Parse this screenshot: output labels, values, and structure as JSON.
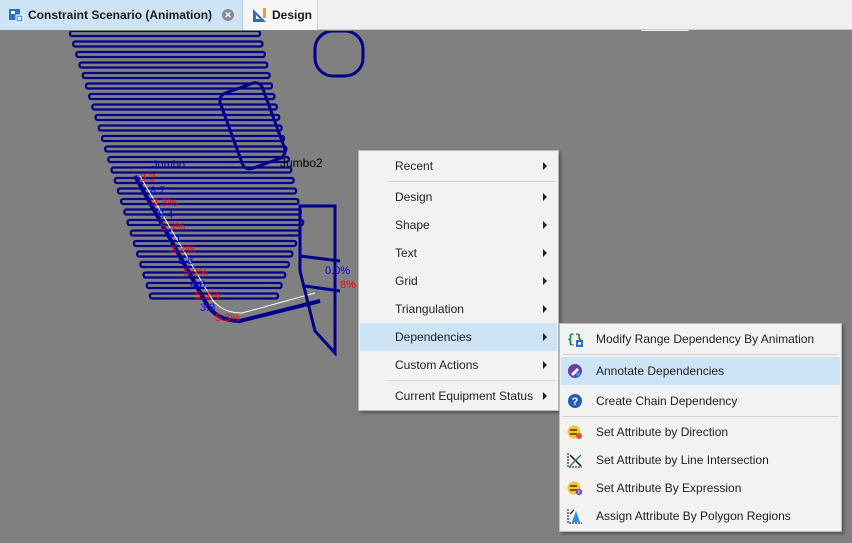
{
  "tabs": [
    {
      "label": "Constraint Scenario (Animation)",
      "icon": "scenario-icon",
      "active": true,
      "closable": true
    },
    {
      "label": "Design",
      "icon": "design-icon",
      "active": false
    }
  ],
  "scene": {
    "labels": {
      "jumbo2": "Jumbo2",
      "jumbo_partial": "Jumbo"
    },
    "percent_labels": [
      "3.3",
      "8.7",
      "3.3%",
      "8.4",
      "5.3%",
      "7.1",
      "3.3%",
      "5.8",
      "5.3%",
      "4.6",
      "5.3%",
      "3.3",
      "5.3%",
      "0.0%",
      "8%"
    ]
  },
  "context_menu": {
    "items": [
      {
        "label": "Recent",
        "has_submenu": true
      },
      {
        "label": "Design",
        "has_submenu": true
      },
      {
        "label": "Shape",
        "has_submenu": true
      },
      {
        "label": "Text",
        "has_submenu": true
      },
      {
        "label": "Grid",
        "has_submenu": true
      },
      {
        "label": "Triangulation",
        "has_submenu": true
      },
      {
        "label": "Dependencies",
        "has_submenu": true,
        "highlighted": true
      },
      {
        "label": "Custom Actions",
        "has_submenu": true
      },
      {
        "label": "Current Equipment Status",
        "has_submenu": true
      }
    ]
  },
  "submenu": {
    "items": [
      {
        "label": "Modify Range Dependency By Animation",
        "icon": "braces-icon"
      },
      {
        "label": "Annotate Dependencies",
        "icon": "annotate-icon",
        "highlighted": true
      },
      {
        "label": "Create Chain Dependency",
        "icon": "help-circle-icon"
      },
      {
        "label": "Set Attribute by Direction",
        "icon": "attribute-direction-icon"
      },
      {
        "label": "Set Attribute by Line Intersection",
        "icon": "line-intersection-icon"
      },
      {
        "label": "Set Attribute By Expression",
        "icon": "attribute-expression-icon"
      },
      {
        "label": "Assign Attribute By Polygon Regions",
        "icon": "polygon-regions-icon"
      }
    ]
  },
  "colors": {
    "design_lines": "#00008b",
    "annotation_red": "#ff0000",
    "annotation_blue": "#0000ff",
    "highlight": "#cde4f7"
  }
}
